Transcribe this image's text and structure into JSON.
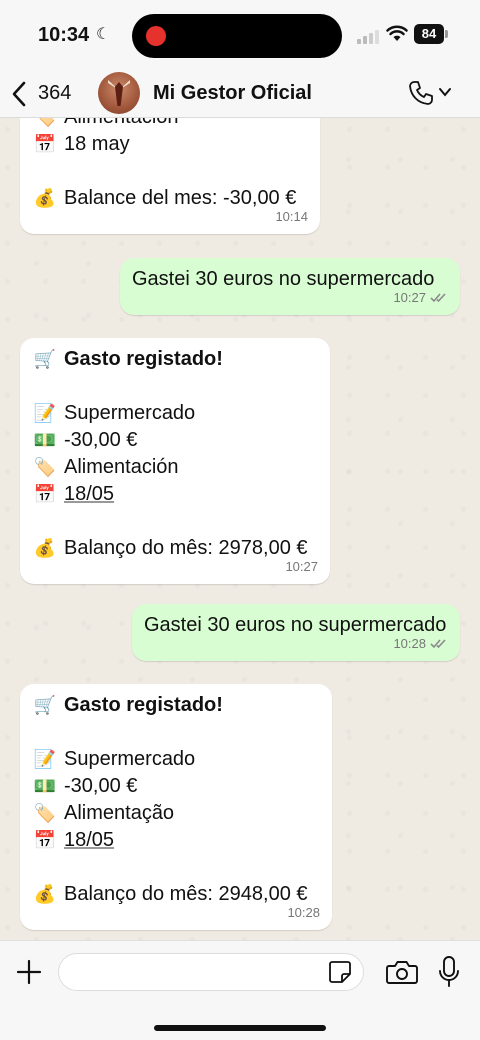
{
  "status_bar": {
    "time": "10:34",
    "battery": "84"
  },
  "header": {
    "back_count": "364",
    "contact_name": "Mi Gestor Oficial"
  },
  "messages": [
    {
      "lines": [
        {
          "icon": "🏷️",
          "text": "Alimentación",
          "style": ""
        },
        {
          "icon": "📅",
          "text": "18 may",
          "style": ""
        },
        {
          "icon": "",
          "text": "",
          "style": "gap"
        },
        {
          "icon": "💰",
          "text": "Balance del mes: -30,00 €",
          "style": ""
        }
      ],
      "time": "10:14"
    },
    {
      "text": "Gastei 30 euros no supermercado",
      "time": "10:27"
    },
    {
      "lines": [
        {
          "icon": "🛒",
          "text": "Gasto registado!",
          "style": "bold"
        },
        {
          "icon": "",
          "text": "",
          "style": "gap"
        },
        {
          "icon": "📝",
          "text": "Supermercado",
          "style": ""
        },
        {
          "icon": "💵",
          "text": "-30,00 €",
          "style": ""
        },
        {
          "icon": "🏷️",
          "text": "Alimentación",
          "style": ""
        },
        {
          "icon": "📅",
          "text": "18/05",
          "style": "underline"
        },
        {
          "icon": "",
          "text": "",
          "style": "gap"
        },
        {
          "icon": "💰",
          "text": "Balanço do mês: 2978,00 €",
          "style": ""
        }
      ],
      "time": "10:27"
    },
    {
      "text": "Gastei 30 euros no supermercado",
      "time": "10:28"
    },
    {
      "lines": [
        {
          "icon": "🛒",
          "text": "Gasto registado!",
          "style": "bold"
        },
        {
          "icon": "",
          "text": "",
          "style": "gap"
        },
        {
          "icon": "📝",
          "text": "Supermercado",
          "style": ""
        },
        {
          "icon": "💵",
          "text": "-30,00 €",
          "style": ""
        },
        {
          "icon": "🏷️",
          "text": "Alimentação",
          "style": ""
        },
        {
          "icon": "📅",
          "text": "18/05",
          "style": "underline"
        },
        {
          "icon": "",
          "text": "",
          "style": "gap"
        },
        {
          "icon": "💰",
          "text": "Balanço do mês: 2948,00 €",
          "style": ""
        }
      ],
      "time": "10:28"
    }
  ],
  "composer": {
    "placeholder": ""
  },
  "icons": {
    "moon": "moon-icon",
    "signal": "signal-icon",
    "wifi": "wifi-icon",
    "back": "chevron-left-icon",
    "call": "phone-icon",
    "plus": "plus-icon",
    "sticker": "sticker-icon",
    "camera": "camera-icon",
    "mic": "microphone-icon"
  },
  "colors": {
    "incoming": "#ffffff",
    "outgoing": "#d9fdd3",
    "background": "#efeae2",
    "read_ticks": "#8a8a8a"
  }
}
